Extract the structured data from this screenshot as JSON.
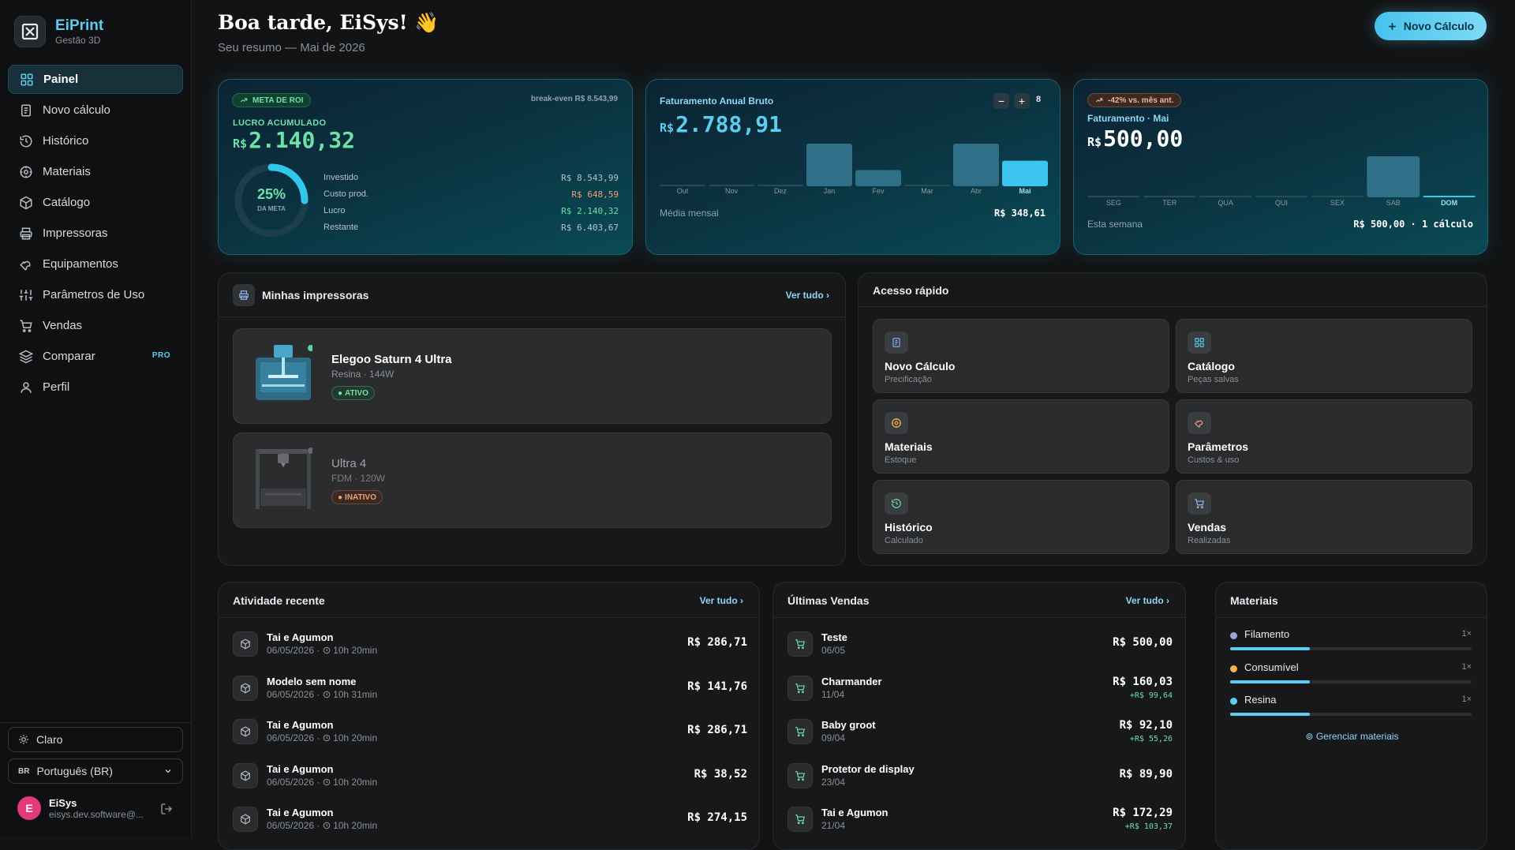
{
  "brand": {
    "name": "EiPrint",
    "subtitle": "Gestão 3D"
  },
  "nav": [
    {
      "label": "Painel",
      "icon": "grid-icon",
      "active": true
    },
    {
      "label": "Novo cálculo",
      "icon": "document-icon"
    },
    {
      "label": "Histórico",
      "icon": "history-icon"
    },
    {
      "label": "Materiais",
      "icon": "target-icon"
    },
    {
      "label": "Catálogo",
      "icon": "cube-icon"
    },
    {
      "label": "Impressoras",
      "icon": "printer-icon"
    },
    {
      "label": "Equipamentos",
      "icon": "wrench-icon"
    },
    {
      "label": "Parâmetros de Uso",
      "icon": "sliders-icon"
    },
    {
      "label": "Vendas",
      "icon": "cart-icon"
    },
    {
      "label": "Comparar",
      "icon": "layers-icon",
      "badge": "PRO"
    },
    {
      "label": "Perfil",
      "icon": "user-icon"
    }
  ],
  "sidebar_bottom": {
    "theme_label": "Claro",
    "lang_code": "BR",
    "lang_label": "Português (BR)"
  },
  "user": {
    "initial": "E",
    "name": "EiSys",
    "email": "eisys.dev.software@..."
  },
  "header": {
    "greeting": "Boa tarde, EiSys! 👋",
    "subtitle": "Seu resumo — Mai de 2026",
    "new_button": "Novo Cálculo"
  },
  "roi": {
    "badge": "META DE ROI",
    "breakeven": "break-even R$ 8.543,99",
    "label": "LUCRO ACUMULADO",
    "currency": "R$",
    "value": "2.140,32",
    "percent": "25%",
    "percent_value": 25,
    "percent_label": "DA META",
    "stats": [
      {
        "label": "Investido",
        "value": "R$ 8.543,99",
        "color": "#b6c1c8"
      },
      {
        "label": "Custo prod.",
        "value": "R$ 648,59",
        "color": "#f0a070"
      },
      {
        "label": "Lucro",
        "value": "R$ 2.140,32",
        "color": "#6fe0a7"
      },
      {
        "label": "Restante",
        "value": "R$ 6.403,67",
        "color": "#b6c1c8"
      }
    ]
  },
  "annual": {
    "title": "Faturamento Anual Bruto",
    "currency": "R$",
    "value": "2.788,91",
    "count": "8",
    "avg_label": "Média mensal",
    "avg_value": "R$ 348,61"
  },
  "monthly": {
    "badge": "-42% vs. mês ant.",
    "title": "Faturamento · Mai",
    "currency": "R$",
    "value": "500,00",
    "footer_label": "Esta semana",
    "footer_value": "R$ 500,00 · 1 cálculo"
  },
  "chart_data": [
    {
      "type": "bar",
      "categories": [
        "Out",
        "Nov",
        "Dez",
        "Jan",
        "Fev",
        "Mar",
        "Abr",
        "Mai"
      ],
      "values": [
        0,
        0,
        0,
        1000,
        380,
        0,
        1000,
        600
      ],
      "highlight": "Mai"
    },
    {
      "type": "bar",
      "categories": [
        "SEG",
        "TER",
        "QUA",
        "QUI",
        "SEX",
        "SAB",
        "DOM"
      ],
      "values": [
        0,
        0,
        0,
        0,
        0,
        500,
        0
      ],
      "highlight": "DOM"
    }
  ],
  "printers": {
    "title": "Minhas impressoras",
    "see_all": "Ver tudo",
    "items": [
      {
        "name": "Elegoo Saturn 4 Ultra",
        "meta": "Resina · 144W",
        "status": "ATIVO"
      },
      {
        "name": "Ultra 4",
        "meta": "FDM · 120W",
        "status": "INATIVO"
      }
    ]
  },
  "quick": {
    "title": "Acesso rápido",
    "items": [
      {
        "title": "Novo Cálculo",
        "sub": "Precificação",
        "icon": "document-icon",
        "color": "#7fb0e8"
      },
      {
        "title": "Catálogo",
        "sub": "Peças salvas",
        "icon": "grid-icon",
        "color": "#5ccdf0"
      },
      {
        "title": "Materiais",
        "sub": "Estoque",
        "icon": "target-icon",
        "color": "#f0b44a"
      },
      {
        "title": "Parâmetros",
        "sub": "Custos & uso",
        "icon": "wrench-icon",
        "color": "#e89a72"
      },
      {
        "title": "Histórico",
        "sub": "Calculado",
        "icon": "history-icon",
        "color": "#6fe0a7"
      },
      {
        "title": "Vendas",
        "sub": "Realizadas",
        "icon": "cart-icon",
        "color": "#8fb8e8"
      }
    ]
  },
  "activity": {
    "title": "Atividade recente",
    "see_all": "Ver tudo",
    "items": [
      {
        "name": "Tai e Agumon",
        "date": "06/05/2026",
        "time": "10h 20min",
        "value": "R$ 286,71"
      },
      {
        "name": "Modelo sem nome",
        "date": "06/05/2026",
        "time": "10h 31min",
        "value": "R$ 141,76"
      },
      {
        "name": "Tai e Agumon",
        "date": "06/05/2026",
        "time": "10h 20min",
        "value": "R$ 286,71"
      },
      {
        "name": "Tai e Agumon",
        "date": "06/05/2026",
        "time": "10h 20min",
        "value": "R$ 38,52"
      },
      {
        "name": "Tai e Agumon",
        "date": "06/05/2026",
        "time": "10h 20min",
        "value": "R$ 274,15"
      }
    ]
  },
  "sales": {
    "title": "Últimas Vendas",
    "see_all": "Ver tudo",
    "items": [
      {
        "name": "Teste",
        "date": "06/05",
        "value": "R$ 500,00",
        "profit": ""
      },
      {
        "name": "Charmander",
        "date": "11/04",
        "value": "R$ 160,03",
        "profit": "+R$ 99,64"
      },
      {
        "name": "Baby groot",
        "date": "09/04",
        "value": "R$ 92,10",
        "profit": "+R$ 55,26"
      },
      {
        "name": "Protetor de display",
        "date": "23/04",
        "value": "R$ 89,90",
        "profit": ""
      },
      {
        "name": "Tai e Agumon",
        "date": "21/04",
        "value": "R$ 172,29",
        "profit": "+R$ 103,37"
      }
    ]
  },
  "materials": {
    "title": "Materiais",
    "manage": "Gerenciar materiais",
    "items": [
      {
        "name": "Filamento",
        "count": "1×",
        "dot": "#9aa8d8",
        "fill": 0.33
      },
      {
        "name": "Consumível",
        "count": "1×",
        "dot": "#f0b44a",
        "fill": 0.33
      },
      {
        "name": "Resina",
        "count": "1×",
        "dot": "#5ccdf0",
        "fill": 0.33
      }
    ]
  }
}
